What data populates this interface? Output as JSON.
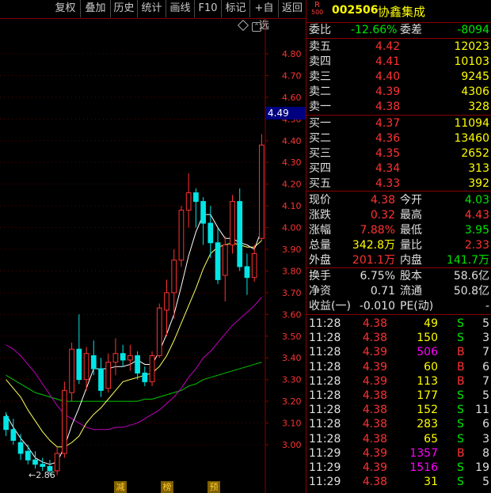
{
  "toolbar": {
    "items": [
      "复权",
      "叠加",
      "历史",
      "统计",
      "画线",
      "F10",
      "标记",
      "+自选",
      "返回"
    ]
  },
  "header": {
    "badge_top": "R",
    "badge_bottom": "500",
    "code": "002506",
    "name": "协鑫集成"
  },
  "commission": {
    "ratio_label": "委比",
    "ratio_value": "-12.66%",
    "diff_label": "委差",
    "diff_value": "-8094"
  },
  "asks": [
    {
      "label": "卖五",
      "price": "4.42",
      "volume": "12023"
    },
    {
      "label": "卖四",
      "price": "4.41",
      "volume": "10103"
    },
    {
      "label": "卖三",
      "price": "4.40",
      "volume": "9245"
    },
    {
      "label": "卖二",
      "price": "4.39",
      "volume": "4306"
    },
    {
      "label": "卖一",
      "price": "4.38",
      "volume": "328"
    }
  ],
  "bids": [
    {
      "label": "买一",
      "price": "4.37",
      "volume": "11094"
    },
    {
      "label": "买二",
      "price": "4.36",
      "volume": "13460"
    },
    {
      "label": "买三",
      "price": "4.35",
      "volume": "2652"
    },
    {
      "label": "买四",
      "price": "4.34",
      "volume": "313"
    },
    {
      "label": "买五",
      "price": "4.33",
      "volume": "392"
    }
  ],
  "stats": [
    {
      "l1": "现价",
      "v1": "4.38",
      "c1": "red",
      "l2": "今开",
      "v2": "4.03",
      "c2": "green"
    },
    {
      "l1": "涨跌",
      "v1": "0.32",
      "c1": "red",
      "l2": "最高",
      "v2": "4.43",
      "c2": "red"
    },
    {
      "l1": "涨幅",
      "v1": "7.88%",
      "c1": "red",
      "l2": "最低",
      "v2": "3.95",
      "c2": "green"
    },
    {
      "l1": "总量",
      "v1": "342.8万",
      "c1": "yellow",
      "l2": "量比",
      "v2": "2.33",
      "c2": "red"
    },
    {
      "l1": "外盘",
      "v1": "201.1万",
      "c1": "red",
      "l2": "内盘",
      "v2": "141.7万",
      "c2": "green"
    }
  ],
  "fundamentals": [
    {
      "l1": "换手",
      "v1": "6.75%",
      "l2": "股本",
      "v2": "58.6亿"
    },
    {
      "l1": "净资",
      "v1": "0.71",
      "l2": "流通",
      "v2": "50.8亿"
    },
    {
      "l1": "收益(一)",
      "v1": "-0.010",
      "l2": "PE(动)",
      "v2": "-"
    }
  ],
  "ticks": [
    {
      "time": "11:28",
      "price": "4.38",
      "vol": "49",
      "vc": "yellow",
      "side": "S",
      "n": "5"
    },
    {
      "time": "11:28",
      "price": "4.38",
      "vol": "150",
      "vc": "yellow",
      "side": "S",
      "n": "3"
    },
    {
      "time": "11:28",
      "price": "4.39",
      "vol": "506",
      "vc": "magenta",
      "side": "B",
      "n": "7"
    },
    {
      "time": "11:28",
      "price": "4.39",
      "vol": "60",
      "vc": "yellow",
      "side": "B",
      "n": "6"
    },
    {
      "time": "11:28",
      "price": "4.39",
      "vol": "113",
      "vc": "yellow",
      "side": "B",
      "n": "7"
    },
    {
      "time": "11:28",
      "price": "4.38",
      "vol": "177",
      "vc": "yellow",
      "side": "S",
      "n": "5"
    },
    {
      "time": "11:28",
      "price": "4.38",
      "vol": "152",
      "vc": "yellow",
      "side": "S",
      "n": "11"
    },
    {
      "time": "11:28",
      "price": "4.38",
      "vol": "283",
      "vc": "yellow",
      "side": "S",
      "n": "6"
    },
    {
      "time": "11:28",
      "price": "4.38",
      "vol": "65",
      "vc": "yellow",
      "side": "S",
      "n": "3"
    },
    {
      "time": "11:29",
      "price": "4.39",
      "vol": "1357",
      "vc": "magenta",
      "side": "B",
      "n": "8"
    },
    {
      "time": "11:29",
      "price": "4.39",
      "vol": "1516",
      "vc": "magenta",
      "side": "S",
      "n": "19"
    },
    {
      "time": "11:29",
      "price": "4.38",
      "vol": "31",
      "vc": "yellow",
      "side": "S",
      "n": "5"
    }
  ],
  "chart": {
    "current_price_tag": "4.49",
    "y_ticks": [
      "4.80",
      "4.70",
      "4.60",
      "4.50",
      "4.40",
      "4.30",
      "4.20",
      "4.10",
      "4.00",
      "3.90",
      "3.80",
      "3.70",
      "3.60",
      "3.50",
      "3.40",
      "3.30",
      "3.20",
      "3.10",
      "3.00"
    ],
    "low_marker": "2.86",
    "bottom_tags": [
      "减",
      "榜",
      "预"
    ]
  },
  "chart_data": {
    "type": "candlestick",
    "ylim": [
      2.84,
      4.88
    ],
    "candles": [
      {
        "o": 3.13,
        "h": 3.15,
        "l": 3.04,
        "c": 3.07
      },
      {
        "o": 3.07,
        "h": 3.12,
        "l": 3.0,
        "c": 3.02
      },
      {
        "o": 3.01,
        "h": 3.05,
        "l": 2.93,
        "c": 2.96
      },
      {
        "o": 2.97,
        "h": 3.0,
        "l": 2.91,
        "c": 2.93
      },
      {
        "o": 2.93,
        "h": 2.97,
        "l": 2.89,
        "c": 2.91
      },
      {
        "o": 2.91,
        "h": 2.94,
        "l": 2.88,
        "c": 2.9
      },
      {
        "o": 2.9,
        "h": 2.93,
        "l": 2.86,
        "c": 2.88
      },
      {
        "o": 2.88,
        "h": 2.99,
        "l": 2.86,
        "c": 2.96
      },
      {
        "o": 2.96,
        "h": 3.29,
        "l": 2.94,
        "c": 3.25
      },
      {
        "o": 3.24,
        "h": 3.47,
        "l": 3.2,
        "c": 3.44
      },
      {
        "o": 3.44,
        "h": 3.6,
        "l": 3.28,
        "c": 3.3
      },
      {
        "o": 3.3,
        "h": 3.45,
        "l": 3.25,
        "c": 3.42
      },
      {
        "o": 3.41,
        "h": 3.48,
        "l": 3.32,
        "c": 3.35
      },
      {
        "o": 3.35,
        "h": 3.4,
        "l": 3.22,
        "c": 3.25
      },
      {
        "o": 3.26,
        "h": 3.42,
        "l": 3.24,
        "c": 3.38
      },
      {
        "o": 3.38,
        "h": 3.49,
        "l": 3.32,
        "c": 3.42
      },
      {
        "o": 3.42,
        "h": 3.46,
        "l": 3.36,
        "c": 3.39
      },
      {
        "o": 3.39,
        "h": 3.46,
        "l": 3.34,
        "c": 3.41
      },
      {
        "o": 3.41,
        "h": 3.43,
        "l": 3.3,
        "c": 3.33
      },
      {
        "o": 3.33,
        "h": 3.36,
        "l": 3.27,
        "c": 3.29
      },
      {
        "o": 3.29,
        "h": 3.43,
        "l": 3.27,
        "c": 3.41
      },
      {
        "o": 3.41,
        "h": 3.65,
        "l": 3.4,
        "c": 3.63
      },
      {
        "o": 3.62,
        "h": 3.76,
        "l": 3.5,
        "c": 3.7
      },
      {
        "o": 3.7,
        "h": 3.9,
        "l": 3.58,
        "c": 3.85
      },
      {
        "o": 3.85,
        "h": 4.1,
        "l": 3.82,
        "c": 4.08
      },
      {
        "o": 4.08,
        "h": 4.25,
        "l": 4.0,
        "c": 4.16
      },
      {
        "o": 4.16,
        "h": 4.18,
        "l": 4.0,
        "c": 4.12
      },
      {
        "o": 4.12,
        "h": 4.14,
        "l": 3.92,
        "c": 4.02
      },
      {
        "o": 4.02,
        "h": 4.1,
        "l": 3.86,
        "c": 3.93
      },
      {
        "o": 3.93,
        "h": 4.0,
        "l": 3.74,
        "c": 3.76
      },
      {
        "o": 3.78,
        "h": 3.96,
        "l": 3.66,
        "c": 3.92
      },
      {
        "o": 3.92,
        "h": 4.15,
        "l": 3.88,
        "c": 4.12
      },
      {
        "o": 4.12,
        "h": 4.18,
        "l": 3.8,
        "c": 3.82
      },
      {
        "o": 3.82,
        "h": 3.88,
        "l": 3.69,
        "c": 3.77
      },
      {
        "o": 3.77,
        "h": 3.92,
        "l": 3.75,
        "c": 3.88
      },
      {
        "o": 3.95,
        "h": 4.43,
        "l": 3.94,
        "c": 4.38
      }
    ],
    "ma5": [
      3.14,
      3.08,
      3.03,
      2.99,
      2.94,
      2.92,
      2.91,
      2.92,
      2.99,
      3.09,
      3.17,
      3.26,
      3.35,
      3.35,
      3.35,
      3.36,
      3.36,
      3.37,
      3.39,
      3.37,
      3.37,
      3.43,
      3.51,
      3.6,
      3.73,
      3.87,
      3.98,
      4.06,
      4.06,
      4.0,
      3.95,
      3.95,
      3.93,
      3.92,
      3.9,
      3.99
    ],
    "ma10": [
      3.3,
      3.26,
      3.22,
      3.16,
      3.11,
      3.06,
      3.02,
      2.99,
      2.99,
      3.01,
      3.04,
      3.1,
      3.14,
      3.17,
      3.21,
      3.25,
      3.29,
      3.3,
      3.31,
      3.32,
      3.33,
      3.36,
      3.41,
      3.48,
      3.56,
      3.64,
      3.72,
      3.81,
      3.88,
      3.91,
      3.92,
      3.93,
      3.92,
      3.91,
      3.91,
      3.94
    ],
    "ma20": [
      3.46,
      3.44,
      3.41,
      3.37,
      3.33,
      3.28,
      3.23,
      3.18,
      3.14,
      3.12,
      3.1,
      3.08,
      3.07,
      3.07,
      3.07,
      3.08,
      3.08,
      3.09,
      3.1,
      3.12,
      3.14,
      3.16,
      3.19,
      3.22,
      3.26,
      3.31,
      3.35,
      3.4,
      3.43,
      3.47,
      3.51,
      3.55,
      3.58,
      3.61,
      3.64,
      3.68
    ],
    "ma60": [
      3.32,
      3.3,
      3.28,
      3.26,
      3.24,
      3.23,
      3.22,
      3.21,
      3.2,
      3.2,
      3.2,
      3.2,
      3.2,
      3.2,
      3.2,
      3.2,
      3.2,
      3.2,
      3.2,
      3.21,
      3.21,
      3.22,
      3.23,
      3.24,
      3.25,
      3.27,
      3.28,
      3.3,
      3.31,
      3.32,
      3.33,
      3.34,
      3.35,
      3.36,
      3.37,
      3.38
    ]
  }
}
